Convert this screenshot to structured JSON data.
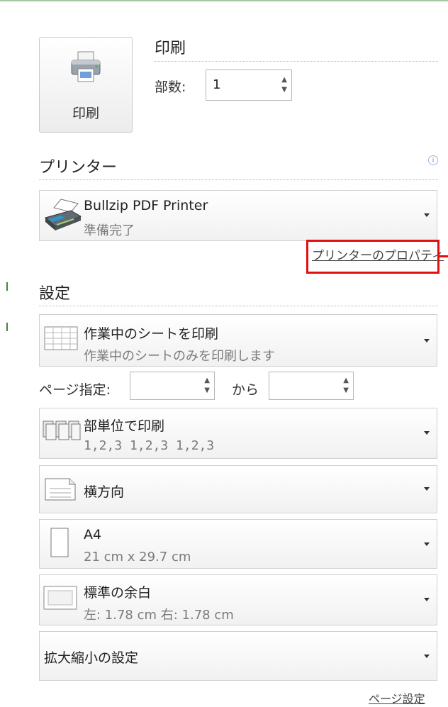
{
  "print_button": {
    "label": "印刷",
    "icon": "printer-icon"
  },
  "print_section": {
    "title": "印刷",
    "copies_label": "部数:",
    "copies_value": "1"
  },
  "printer": {
    "title": "プリンター",
    "info_icon": "i",
    "name": "Bullzip PDF Printer",
    "status": "準備完了",
    "properties_link": "プリンターのプロパティ"
  },
  "settings": {
    "title": "設定",
    "print_what": {
      "main": "作業中のシートを印刷",
      "sub": "作業中のシートのみを印刷します"
    },
    "pages": {
      "label": "ページ指定:",
      "from_value": "",
      "to_label": "から",
      "to_value": ""
    },
    "collation": {
      "main": "部単位で印刷",
      "sub": "1,2,3   1,2,3   1,2,3"
    },
    "orientation": {
      "main": "横方向"
    },
    "paper_size": {
      "main": "A4",
      "sub": "21 cm x 29.7 cm"
    },
    "margins": {
      "main": "標準の余白",
      "sub": "左:  1.78 cm    右:  1.78 cm"
    },
    "scaling": {
      "main": "拡大縮小の設定"
    },
    "page_setup_link": "ページ設定"
  },
  "colors": {
    "highlight": "#e01010",
    "accent": "#5a9e5a"
  }
}
